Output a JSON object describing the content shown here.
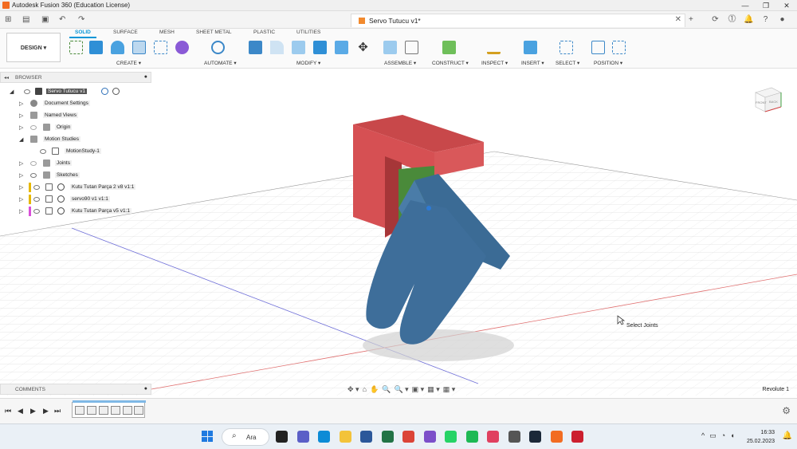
{
  "window": {
    "title": "Autodesk Fusion 360 (Education License)",
    "min": "—",
    "max": "❐",
    "close": "✕"
  },
  "tabs": {
    "document_title": "Servo Tutucu v1*",
    "close": "✕",
    "add": "+"
  },
  "quick_access": {
    "grid": "⊞",
    "file": "▤",
    "save": "▣",
    "undo": "↶",
    "redo": "↷"
  },
  "header_icons": [
    "⟳",
    "⓵",
    "🔔",
    "?",
    "●"
  ],
  "workspace": {
    "label": "DESIGN ▾"
  },
  "toolbar": {
    "tabs": [
      "SOLID",
      "SURFACE",
      "MESH",
      "SHEET METAL",
      "PLASTIC",
      "UTILITIES"
    ],
    "groups": [
      "CREATE ▾",
      "AUTOMATE ▾",
      "MODIFY ▾",
      "ASSEMBLE ▾",
      "CONSTRUCT ▾",
      "INSPECT ▾",
      "INSERT ▾",
      "SELECT ▾",
      "POSITION ▾"
    ]
  },
  "browser": {
    "title": "BROWSER",
    "collapse": "◂◂",
    "root": "Servo Tutucu v1",
    "items": [
      {
        "label": "Document Settings"
      },
      {
        "label": "Named Views"
      },
      {
        "label": "Origin"
      },
      {
        "label": "Motion Studies"
      },
      {
        "label": "MotionStudy-1"
      },
      {
        "label": "Joints"
      },
      {
        "label": "Sketches"
      },
      {
        "label": "Kutu Tutan Parça 2 v8 v1:1"
      },
      {
        "label": "servo90 v1 v1:1"
      },
      {
        "label": "Kutu Tutan Parça v5 v1:1"
      }
    ],
    "component_colors": [
      "#e6b800",
      "#e6b800",
      "#d84fd8"
    ]
  },
  "viewcube": {
    "front": "FRONT",
    "back": "BACK"
  },
  "viewport": {
    "cursor_tooltip": "Select Joints",
    "status": "Revolute 1"
  },
  "comments": {
    "label": "COMMENTS"
  },
  "navbar": [
    "✥ ▾",
    "⌂",
    "✋",
    "🔍",
    "🔍 ▾",
    "▣ ▾",
    "▦ ▾",
    "▦ ▾"
  ],
  "timeline": {
    "controls": [
      "⏮",
      "◀",
      "▶",
      "▶",
      "⏭"
    ]
  },
  "taskbar": {
    "search_label": "Ara",
    "apps": [
      {
        "name": "file-explorer",
        "color": "#222222"
      },
      {
        "name": "video",
        "color": "#5b5fc7"
      },
      {
        "name": "edge",
        "color": "#0c8bd6"
      },
      {
        "name": "folder",
        "color": "#f3c33a"
      },
      {
        "name": "word",
        "color": "#2b579a"
      },
      {
        "name": "excel",
        "color": "#217346"
      },
      {
        "name": "chrome",
        "color": "#db4437"
      },
      {
        "name": "visual-studio",
        "color": "#7b4ec9"
      },
      {
        "name": "whatsapp",
        "color": "#25d366"
      },
      {
        "name": "spotify",
        "color": "#1db954"
      },
      {
        "name": "snip",
        "color": "#e04060"
      },
      {
        "name": "calculator",
        "color": "#555555"
      },
      {
        "name": "steam",
        "color": "#1b2838"
      },
      {
        "name": "fusion",
        "color": "#f26c22"
      },
      {
        "name": "autodesk",
        "color": "#cc1f2f"
      }
    ],
    "time": "16:33",
    "date": "25.02.2023"
  }
}
